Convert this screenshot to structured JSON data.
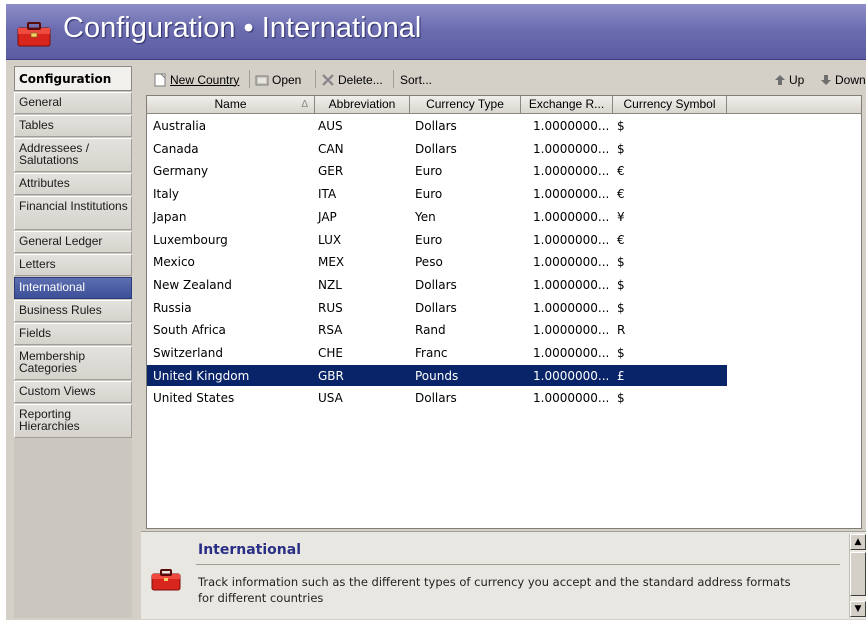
{
  "header": {
    "title": "Configuration • International"
  },
  "sidebar": {
    "heading": "Configuration",
    "items": [
      {
        "label": "General",
        "lines": 1
      },
      {
        "label": "Tables",
        "lines": 1
      },
      {
        "label": "Addressees / Salutations",
        "lines": 2
      },
      {
        "label": "Attributes",
        "lines": 1
      },
      {
        "label": "Financial Institutions",
        "lines": 2
      },
      {
        "label": "General Ledger",
        "lines": 1
      },
      {
        "label": "Letters",
        "lines": 1
      },
      {
        "label": "International",
        "lines": 1,
        "active": true
      },
      {
        "label": "Business Rules",
        "lines": 1
      },
      {
        "label": "Fields",
        "lines": 1
      },
      {
        "label": "Membership Categories",
        "lines": 2
      },
      {
        "label": "Custom Views",
        "lines": 1
      },
      {
        "label": "Reporting Hierarchies",
        "lines": 2
      }
    ]
  },
  "toolbar": {
    "new_country": "New Country",
    "open": "Open",
    "delete": "Delete...",
    "sort": "Sort...",
    "up": "Up",
    "down": "Down"
  },
  "grid": {
    "columns": [
      "Name",
      "Abbreviation",
      "Currency Type",
      "Exchange R...",
      "Currency Symbol"
    ],
    "sort_indicator": "Δ",
    "rows": [
      [
        "Australia",
        "AUS",
        "Dollars",
        "1.0000000...",
        "$"
      ],
      [
        "Canada",
        "CAN",
        "Dollars",
        "1.0000000...",
        "$"
      ],
      [
        "Germany",
        "GER",
        "Euro",
        "1.0000000...",
        "€"
      ],
      [
        "Italy",
        "ITA",
        "Euro",
        "1.0000000...",
        "€"
      ],
      [
        "Japan",
        "JAP",
        "Yen",
        "1.0000000...",
        "¥"
      ],
      [
        "Luxembourg",
        "LUX",
        "Euro",
        "1.0000000...",
        "€"
      ],
      [
        "Mexico",
        "MEX",
        "Peso",
        "1.0000000...",
        "$"
      ],
      [
        "New Zealand",
        "NZL",
        "Dollars",
        "1.0000000...",
        "$"
      ],
      [
        "Russia",
        "RUS",
        "Dollars",
        "1.0000000...",
        "$"
      ],
      [
        "South Africa",
        "RSA",
        "Rand",
        "1.0000000...",
        "R"
      ],
      [
        "Switzerland",
        "CHE",
        "Franc",
        "1.0000000...",
        "$"
      ],
      [
        "United Kingdom",
        "GBR",
        "Pounds",
        "1.0000000...",
        "£"
      ],
      [
        "United States",
        "USA",
        "Dollars",
        "1.0000000...",
        "$"
      ]
    ],
    "selected_row": 11
  },
  "info": {
    "title": "International",
    "description": "Track information such as the different types of currency you accept and the standard address formats for different countries"
  },
  "colors": {
    "banner": "#6c6db0",
    "selection": "#0a246a",
    "active_nav": "#3c4f98",
    "info_title": "#2a2f86"
  }
}
